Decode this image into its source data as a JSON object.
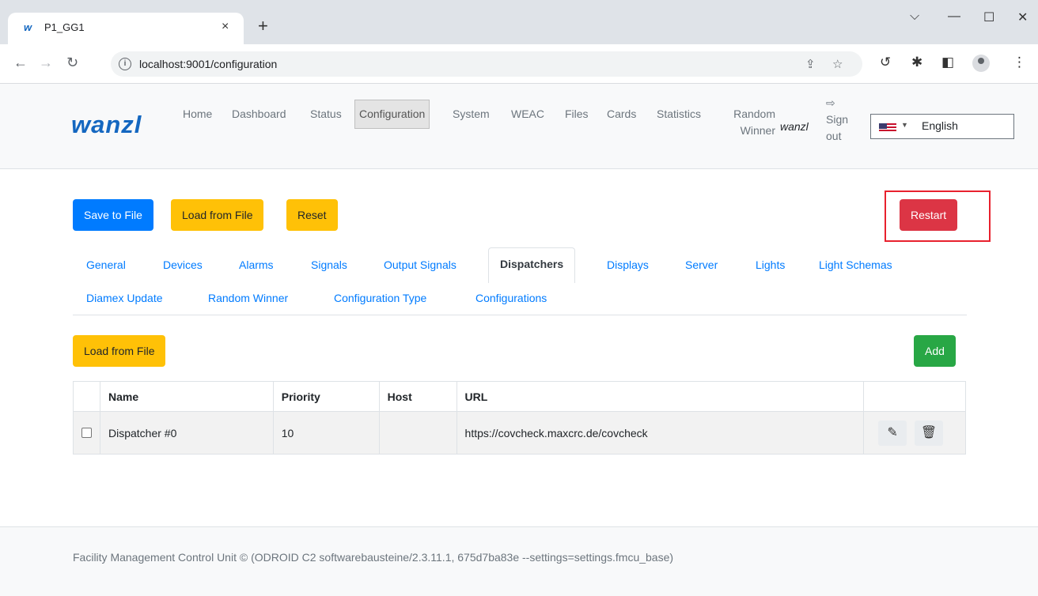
{
  "browser": {
    "tab_favicon": "w",
    "tab_title": "P1_GG1",
    "tab_close": "×",
    "new_tab": "+",
    "url": "localhost:9001/configuration",
    "controls": {
      "chevron": "⌵",
      "minimize": "—",
      "maximize": "☐",
      "close": "✕"
    }
  },
  "navbar": {
    "logo": "wanzl",
    "links": [
      "Home",
      "Dashboard",
      "Status",
      "Configuration",
      "System",
      "WEAC",
      "Files",
      "Cards",
      "Statistics"
    ],
    "random_winner_line1": "Random",
    "random_winner_line2": "Winner",
    "active": "Configuration",
    "user": "wanzl",
    "signout_line1": "Sign",
    "signout_line2": "out",
    "language": "English"
  },
  "toolbar": {
    "save_to_file": "Save to File",
    "load_from_file": "Load from File",
    "reset": "Reset",
    "restart": "Restart"
  },
  "tabs": {
    "row1": [
      "General",
      "Devices",
      "Alarms",
      "Signals",
      "Output Signals",
      "Dispatchers",
      "Displays",
      "Server",
      "Lights",
      "Light Schemas"
    ],
    "row2": [
      "Diamex Update",
      "Random Winner",
      "Configuration Type",
      "Configurations"
    ],
    "active": "Dispatchers"
  },
  "dispatchers": {
    "load_from_file": "Load from File",
    "add": "Add",
    "columns": [
      "Name",
      "Priority",
      "Host",
      "URL"
    ],
    "rows": [
      {
        "name": "Dispatcher #0",
        "priority": "10",
        "host": "",
        "url": "https://covcheck.maxcrc.de/covcheck"
      }
    ]
  },
  "footer": {
    "text": "Facility Management Control Unit © (ODROID C2 softwarebausteine/2.3.11.1, 675d7ba83e --settings=settings.fmcu_base)"
  }
}
